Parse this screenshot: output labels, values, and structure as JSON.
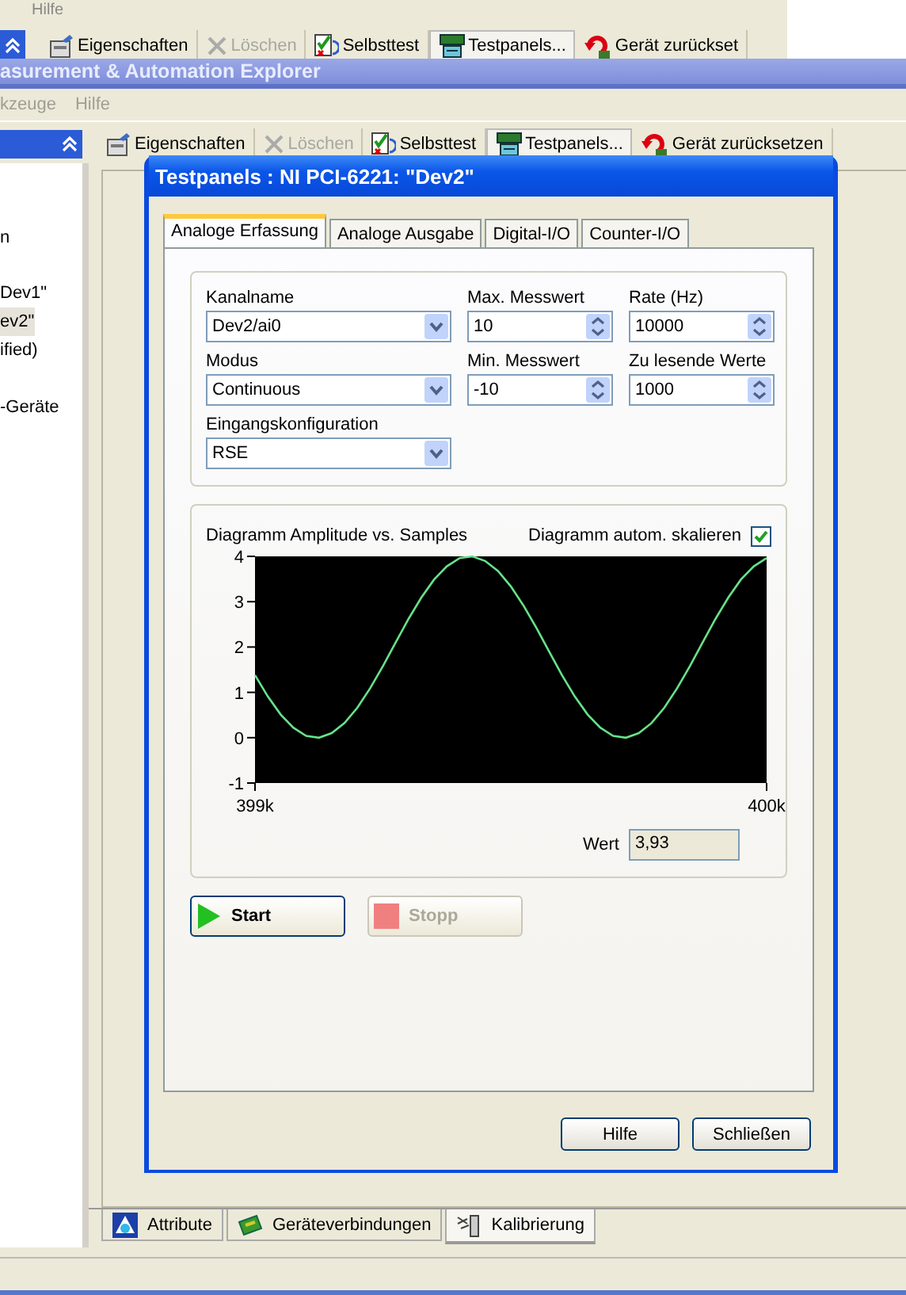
{
  "back_window": {
    "menu": [
      {
        "label": "Hilfe"
      }
    ],
    "toolbar": [
      {
        "kind": "properties",
        "label": "Eigenschaften",
        "disabled": false
      },
      {
        "kind": "delete",
        "label": "Löschen",
        "disabled": true
      },
      {
        "kind": "selftest",
        "label": "Selbsttest",
        "disabled": false
      },
      {
        "kind": "testpanels",
        "label": "Testpanels...",
        "disabled": false
      },
      {
        "kind": "reset",
        "label": "Gerät zurückset",
        "disabled": false
      }
    ]
  },
  "main_window": {
    "title": "asurement & Automation Explorer",
    "menu": [
      {
        "label": "kzeuge"
      },
      {
        "label": "Hilfe"
      }
    ],
    "toolbar": [
      {
        "kind": "properties",
        "label": "Eigenschaften",
        "disabled": false
      },
      {
        "kind": "delete",
        "label": "Löschen",
        "disabled": true
      },
      {
        "kind": "selftest",
        "label": "Selbsttest",
        "disabled": false
      },
      {
        "kind": "testpanels",
        "label": "Testpanels...",
        "disabled": false
      },
      {
        "kind": "reset",
        "label": "Gerät zurücksetzen",
        "disabled": false
      }
    ],
    "tree": [
      {
        "label": "n",
        "selected": false
      },
      {
        "label": "Dev1\"",
        "selected": false
      },
      {
        "label": "ev2\"",
        "selected": true
      },
      {
        "label": "ified)",
        "selected": false
      },
      {
        "label": "-Geräte",
        "selected": false
      }
    ],
    "bottom_tabs": [
      {
        "kind": "attributes",
        "label": "Attribute",
        "selected": false
      },
      {
        "kind": "connections",
        "label": "Geräteverbindungen",
        "selected": false
      },
      {
        "kind": "calibration",
        "label": "Kalibrierung",
        "selected": true
      }
    ]
  },
  "dialog": {
    "title": "Testpanels : NI PCI-6221: \"Dev2\"",
    "tabs": [
      {
        "label": "Analoge Erfassung",
        "selected": true
      },
      {
        "label": "Analoge Ausgabe",
        "selected": false
      },
      {
        "label": "Digital-I/O",
        "selected": false
      },
      {
        "label": "Counter-I/O",
        "selected": false
      }
    ],
    "fields": [
      {
        "kind": "dropdown",
        "label": "Kanalname",
        "value": "Dev2/ai0"
      },
      {
        "kind": "spinner",
        "label": "Max. Messwert",
        "value": "10"
      },
      {
        "kind": "spinner",
        "label": "Rate (Hz)",
        "value": "10000"
      },
      {
        "kind": "dropdown",
        "label": "Modus",
        "value": "Continuous"
      },
      {
        "kind": "spinner",
        "label": "Min. Messwert",
        "value": "-10"
      },
      {
        "kind": "spinner",
        "label": "Zu lesende Werte",
        "value": "1000"
      },
      {
        "kind": "dropdown",
        "label": "Eingangskonfiguration",
        "value": "RSE"
      }
    ],
    "chart": {
      "title": "Diagramm Amplitude vs. Samples",
      "autoscale_label": "Diagramm autom. skalieren",
      "autoscale_checked": true,
      "chart_data": {
        "type": "line",
        "x": [
          399000,
          399025,
          399050,
          399075,
          399100,
          399125,
          399150,
          399175,
          399200,
          399225,
          399250,
          399275,
          399300,
          399325,
          399350,
          399375,
          399400,
          399425,
          399450,
          399475,
          399500,
          399525,
          399550,
          399575,
          399600,
          399625,
          399650,
          399675,
          399700,
          399725,
          399750,
          399775,
          399800,
          399825,
          399850,
          399875,
          399900,
          399925,
          399950,
          399975,
          400000
        ],
        "series": [
          {
            "color": "#66e28a",
            "values": [
              1.38,
              0.91,
              0.51,
              0.22,
              0.04,
              0.0,
              0.1,
              0.32,
              0.66,
              1.09,
              1.58,
              2.1,
              2.62,
              3.09,
              3.49,
              3.78,
              3.96,
              4.0,
              3.9,
              3.68,
              3.34,
              2.91,
              2.42,
              1.9,
              1.38,
              0.91,
              0.51,
              0.22,
              0.04,
              0.0,
              0.1,
              0.32,
              0.66,
              1.09,
              1.58,
              2.1,
              2.62,
              3.09,
              3.49,
              3.78,
              3.96
            ]
          }
        ],
        "xlim": [
          399000,
          400000
        ],
        "ylim": [
          -1,
          4
        ],
        "xticks": [
          {
            "value": 399000,
            "label": "399k"
          },
          {
            "value": 400000,
            "label": "400k"
          }
        ],
        "yticks": [
          -1,
          0,
          1,
          2,
          3,
          4
        ]
      },
      "value_label": "Wert",
      "value": "3,93"
    },
    "buttons": [
      {
        "kind": "start",
        "label": "Start",
        "disabled": false
      },
      {
        "kind": "stop",
        "label": "Stopp",
        "disabled": true
      }
    ],
    "footer_buttons": [
      {
        "label": "Hilfe"
      },
      {
        "label": "Schließen"
      }
    ]
  }
}
